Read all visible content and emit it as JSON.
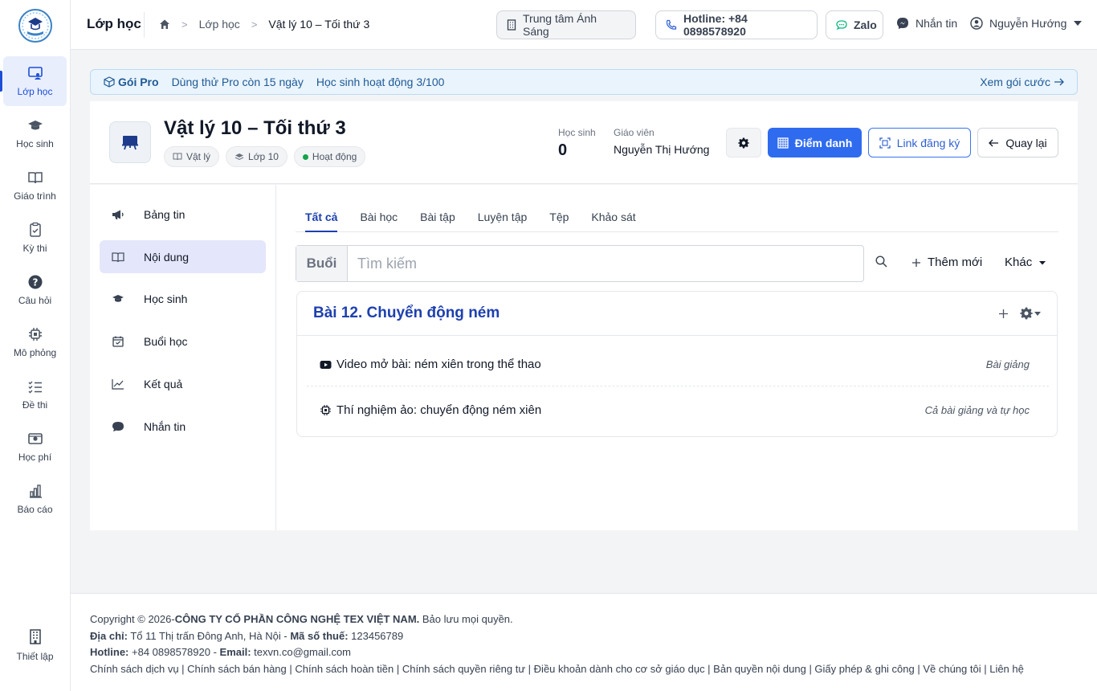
{
  "rail": {
    "items": [
      {
        "label": "Lớp học",
        "icon": "classroom-icon"
      },
      {
        "label": "Học sinh",
        "icon": "graduation-cap-icon"
      },
      {
        "label": "Giáo trình",
        "icon": "book-icon"
      },
      {
        "label": "Kỳ thi",
        "icon": "clipboard-check-icon"
      },
      {
        "label": "Câu hỏi",
        "icon": "question-circle-icon"
      },
      {
        "label": "Mô phỏng",
        "icon": "chip-icon"
      },
      {
        "label": "Đề thi",
        "icon": "list-check-icon"
      },
      {
        "label": "Học phí",
        "icon": "money-icon"
      },
      {
        "label": "Báo cáo",
        "icon": "bar-chart-icon"
      }
    ],
    "settings_label": "Thiết lập"
  },
  "topbar": {
    "title": "Lớp học",
    "breadcrumb": [
      "Lớp học",
      "Vật lý 10 – Tối thứ 3"
    ],
    "center_label": "Trung tâm Ánh Sáng",
    "hotline": "Hotline: +84 0898578920",
    "zalo": "Zalo",
    "messenger": "Nhắn tin",
    "user": "Nguyễn Hướng"
  },
  "banner": {
    "pro": "Gói Pro",
    "trial": "Dùng thử Pro còn 15 ngày",
    "students": "Học sinh hoạt động 3/100",
    "more": "Xem gói cước"
  },
  "classinfo": {
    "name": "Vật lý 10 – Tối thứ 3",
    "tags": {
      "subject": "Vật lý",
      "grade": "Lớp 10",
      "status": "Hoạt động"
    },
    "students_label": "Học sinh",
    "students_value": "0",
    "teacher_label": "Giáo viên",
    "teacher_value": "Nguyễn Thị Hướng",
    "attendance": "Điểm danh",
    "register_link": "Link đăng ký",
    "back": "Quay lại"
  },
  "sidenav": {
    "items": [
      "Bảng tin",
      "Nội dung",
      "Học sinh",
      "Buổi học",
      "Kết quả",
      "Nhắn tin"
    ]
  },
  "tabs": [
    "Tất cả",
    "Bài học",
    "Bài tập",
    "Luyện tập",
    "Tệp",
    "Khảo sát"
  ],
  "search": {
    "addon": "Buổi",
    "placeholder": "Tìm kiếm"
  },
  "toolbar": {
    "add": "Thêm mới",
    "other": "Khác"
  },
  "lesson": {
    "title": "Bài 12. Chuyển động ném",
    "items": [
      {
        "title": "Video mở bài: ném xiên trong thể thao",
        "kind": "Bài giảng"
      },
      {
        "title": "Thí nghiệm ảo: chuyển động ném xiên",
        "kind": "Cả bài giảng và tự học"
      }
    ]
  },
  "footer": {
    "copyright_prefix": "Copyright © 2026-",
    "company": "CÔNG TY CỔ PHẦN CÔNG NGHỆ TEX VIỆT NAM.",
    "rights": " Bảo lưu mọi quyền.",
    "address_label": "Địa chỉ:",
    "address": " Tổ 11 Thị trấn Đông Anh, Hà Nội - ",
    "tax_label": "Mã số thuế:",
    "tax": " 123456789",
    "hotline_label": "Hotline:",
    "hotline": " +84 0898578920 - ",
    "email_label": "Email:",
    "email": " texvn.co@gmail.com",
    "links": "Chính sách dịch vụ | Chính sách bán hàng | Chính sách hoàn tiền | Chính sách quyền riêng tư | Điều khoản dành cho cơ sở giáo dục | Bản quyền nội dung | Giấy phép & ghi công | Về chúng tôi | Liên hệ"
  },
  "colors": {
    "primary": "#2f6bef",
    "accent": "#1e40af",
    "banner_bg": "#eaf4fd",
    "active_nav": "#e4e6fb"
  }
}
